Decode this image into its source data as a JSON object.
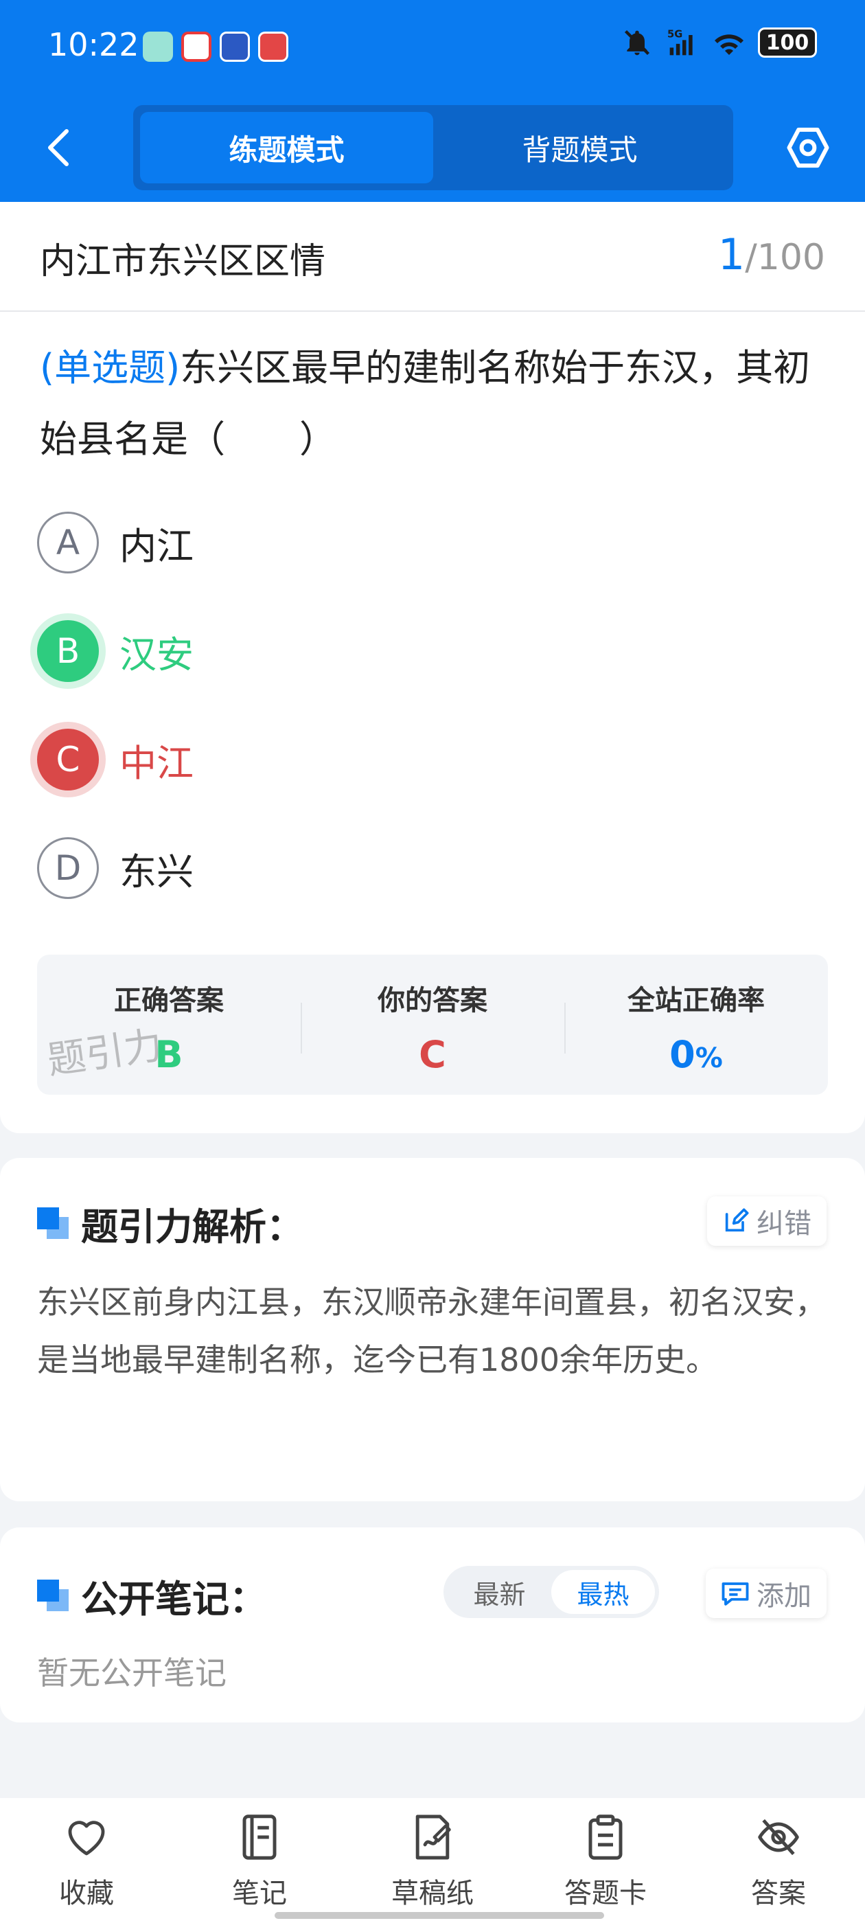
{
  "status_bar": {
    "time": "10:22",
    "battery": "100",
    "icons": [
      "bell-off-icon",
      "signal-5g-icon",
      "wifi-icon",
      "battery-icon"
    ]
  },
  "header": {
    "back_icon": "chevron-left-icon",
    "modes": [
      "练题模式",
      "背题模式"
    ],
    "active_mode": "练题模式",
    "settings_icon": "hexagon-settings-icon"
  },
  "subject": {
    "title": "内江市东兴区区情",
    "current": "1",
    "total": "/100"
  },
  "question": {
    "type": "(单选题)",
    "text": "东兴区最早的建制名称始于东汉，其初始县名是（　　）",
    "options": [
      {
        "letter": "A",
        "text": "内江",
        "state": "normal"
      },
      {
        "letter": "B",
        "text": "汉安",
        "state": "correct"
      },
      {
        "letter": "C",
        "text": "中江",
        "state": "wrong"
      },
      {
        "letter": "D",
        "text": "东兴",
        "state": "normal"
      }
    ]
  },
  "answer_panel": {
    "correct_label": "正确答案",
    "correct_value": "B",
    "yours_label": "你的答案",
    "yours_value": "C",
    "rate_label": "全站正确率",
    "rate_value": "0",
    "rate_unit": "%",
    "watermark": "题引力"
  },
  "analysis": {
    "title": "题引力解析：",
    "correct_button": "纠错",
    "body": "东兴区前身内江县，东汉顺帝永建年间置县，初名汉安，是当地最早建制名称，迄今已有1800余年历史。"
  },
  "notes": {
    "title": "公开笔记：",
    "sort_options": [
      "最新",
      "最热"
    ],
    "active_sort": "最热",
    "add_button": "添加",
    "empty_text": "暂无公开笔记"
  },
  "bottom_nav": [
    {
      "label": "收藏",
      "icon": "heart-icon"
    },
    {
      "label": "笔记",
      "icon": "notebook-icon"
    },
    {
      "label": "草稿纸",
      "icon": "draft-paper-icon"
    },
    {
      "label": "答题卡",
      "icon": "answer-sheet-icon"
    },
    {
      "label": "答案",
      "icon": "eye-off-icon"
    }
  ],
  "colors": {
    "primary": "#0a7bf0",
    "correct": "#2ecc7f",
    "wrong": "#d94848"
  }
}
